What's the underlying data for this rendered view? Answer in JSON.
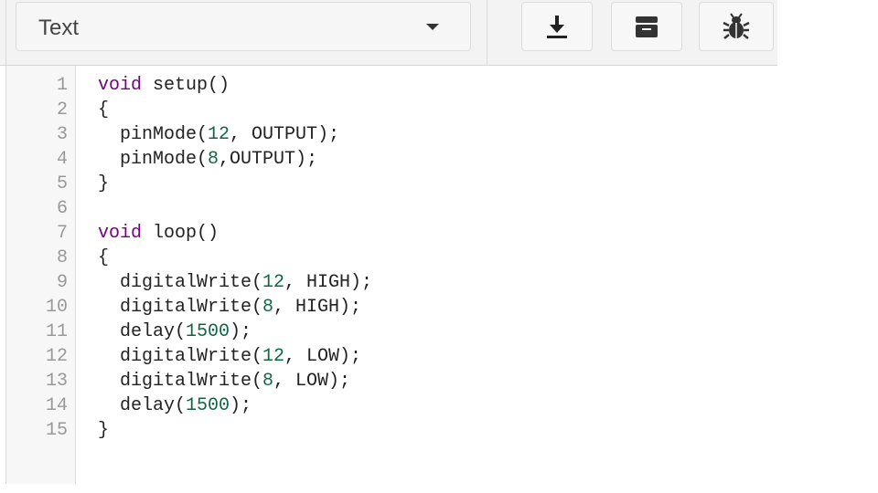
{
  "toolbar": {
    "mode_label": "Text",
    "buttons": [
      {
        "name": "download-button",
        "icon": "download-icon"
      },
      {
        "name": "serial-monitor-button",
        "icon": "serial-monitor-icon"
      },
      {
        "name": "debugger-button",
        "icon": "bug-icon"
      }
    ]
  },
  "editor": {
    "lines": [
      {
        "n": "1",
        "tokens": [
          {
            "t": "kw",
            "v": "void"
          },
          {
            "t": "tx",
            "v": " setup()"
          }
        ]
      },
      {
        "n": "2",
        "tokens": [
          {
            "t": "tx",
            "v": "{"
          }
        ]
      },
      {
        "n": "3",
        "tokens": [
          {
            "t": "tx",
            "v": "  pinMode("
          },
          {
            "t": "num",
            "v": "12"
          },
          {
            "t": "tx",
            "v": ", OUTPUT);"
          }
        ]
      },
      {
        "n": "4",
        "tokens": [
          {
            "t": "tx",
            "v": "  pinMode("
          },
          {
            "t": "num",
            "v": "8"
          },
          {
            "t": "tx",
            "v": ",OUTPUT);"
          }
        ]
      },
      {
        "n": "5",
        "tokens": [
          {
            "t": "tx",
            "v": "}"
          }
        ]
      },
      {
        "n": "6",
        "tokens": []
      },
      {
        "n": "7",
        "tokens": [
          {
            "t": "kw",
            "v": "void"
          },
          {
            "t": "tx",
            "v": " loop()"
          }
        ]
      },
      {
        "n": "8",
        "tokens": [
          {
            "t": "tx",
            "v": "{"
          }
        ]
      },
      {
        "n": "9",
        "tokens": [
          {
            "t": "tx",
            "v": "  digitalWrite("
          },
          {
            "t": "num",
            "v": "12"
          },
          {
            "t": "tx",
            "v": ", HIGH);"
          }
        ]
      },
      {
        "n": "10",
        "tokens": [
          {
            "t": "tx",
            "v": "  digitalWrite("
          },
          {
            "t": "num",
            "v": "8"
          },
          {
            "t": "tx",
            "v": ", HIGH);"
          }
        ]
      },
      {
        "n": "11",
        "tokens": [
          {
            "t": "tx",
            "v": "  delay("
          },
          {
            "t": "num",
            "v": "1500"
          },
          {
            "t": "tx",
            "v": ");"
          }
        ]
      },
      {
        "n": "12",
        "tokens": [
          {
            "t": "tx",
            "v": "  digitalWrite("
          },
          {
            "t": "num",
            "v": "12"
          },
          {
            "t": "tx",
            "v": ", LOW);"
          }
        ]
      },
      {
        "n": "13",
        "tokens": [
          {
            "t": "tx",
            "v": "  digitalWrite("
          },
          {
            "t": "num",
            "v": "8"
          },
          {
            "t": "tx",
            "v": ", LOW);"
          }
        ]
      },
      {
        "n": "14",
        "tokens": [
          {
            "t": "tx",
            "v": "  delay("
          },
          {
            "t": "num",
            "v": "1500"
          },
          {
            "t": "tx",
            "v": ");"
          }
        ]
      },
      {
        "n": "15",
        "tokens": [
          {
            "t": "tx",
            "v": "}"
          }
        ]
      }
    ]
  },
  "colors": {
    "keyword": "#770088",
    "number": "#116644",
    "text": "#222222",
    "line_number": "#999999",
    "toolbar_bg": "#f3f3f3"
  }
}
